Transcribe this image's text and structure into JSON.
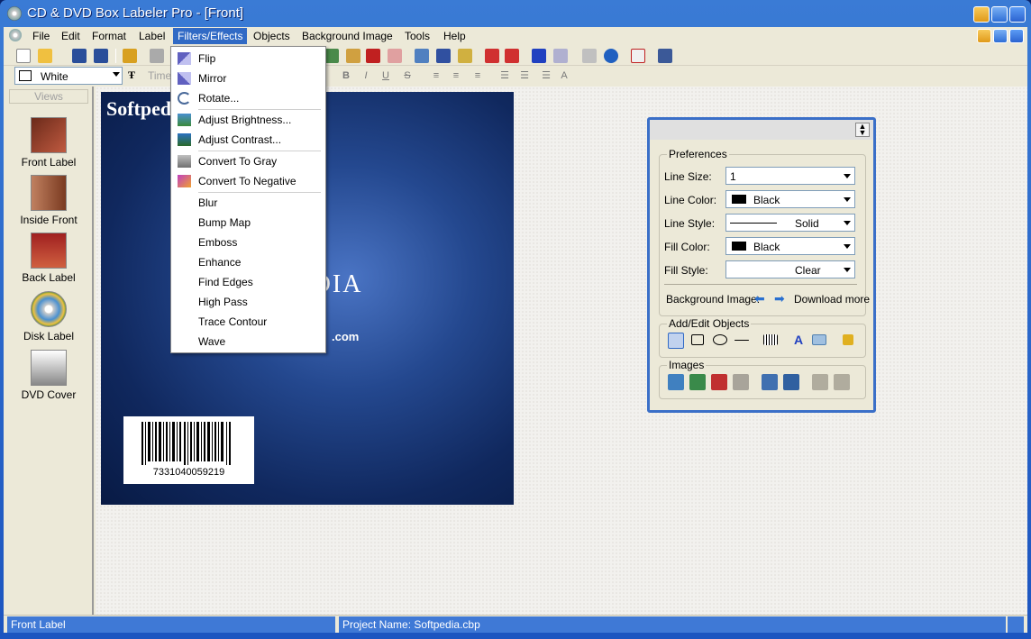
{
  "window": {
    "title": "CD & DVD Box Labeler Pro - [Front]"
  },
  "menubar": {
    "items": [
      "File",
      "Edit",
      "Format",
      "Label",
      "Filters/Effects",
      "Objects",
      "Background Image",
      "Tools",
      "Help"
    ]
  },
  "format_toolbar": {
    "color_value": "White",
    "font_value": "Time"
  },
  "views": {
    "header": "Views",
    "items": [
      {
        "label": "Front Label",
        "icon": "front-label-thumb"
      },
      {
        "label": "Inside Front",
        "icon": "inside-front-thumb"
      },
      {
        "label": "Back Label",
        "icon": "back-label-thumb"
      },
      {
        "label": "Disk Label",
        "icon": "disk-label-thumb"
      },
      {
        "label": "DVD Cover",
        "icon": "dvd-cover-thumb"
      }
    ]
  },
  "cover": {
    "title_text": "Softped",
    "brand_text": "PEDIA",
    "url_text": ".com",
    "barcode_number": "7331040059219"
  },
  "filters_menu": {
    "items": [
      {
        "label": "Flip",
        "icon": "flip-icon"
      },
      {
        "label": "Mirror",
        "icon": "mirror-icon"
      },
      {
        "label": "Rotate...",
        "icon": "rotate-icon"
      },
      {
        "label": "Adjust Brightness...",
        "icon": "brightness-icon"
      },
      {
        "label": "Adjust Contrast...",
        "icon": "contrast-icon"
      },
      {
        "label": "Convert To Gray",
        "icon": "gray-icon"
      },
      {
        "label": "Convert To Negative",
        "icon": "negative-icon"
      },
      {
        "label": "Blur"
      },
      {
        "label": "Bump Map"
      },
      {
        "label": "Emboss"
      },
      {
        "label": "Enhance"
      },
      {
        "label": "Find Edges"
      },
      {
        "label": "High Pass"
      },
      {
        "label": "Trace Contour"
      },
      {
        "label": "Wave"
      }
    ]
  },
  "properties": {
    "preferences_title": "Preferences",
    "line_size_label": "Line Size:",
    "line_size_value": "1",
    "line_color_label": "Line Color:",
    "line_color_value": "Black",
    "line_style_label": "Line Style:",
    "line_style_value": "Solid",
    "fill_color_label": "Fill Color:",
    "fill_color_value": "Black",
    "fill_style_label": "Fill Style:",
    "fill_style_value": "Clear",
    "background_image_label": "Background Image:",
    "download_more": "Download more",
    "add_edit_title": "Add/Edit Objects",
    "images_title": "Images"
  },
  "statusbar": {
    "left": "Front Label",
    "middle": "Project Name: Softpedia.cbp"
  },
  "colors": {
    "title_blue": "#1c55c0",
    "menu_highlight": "#316ac5",
    "chrome": "#ece9d8",
    "status_blue": "#3f79d6"
  }
}
